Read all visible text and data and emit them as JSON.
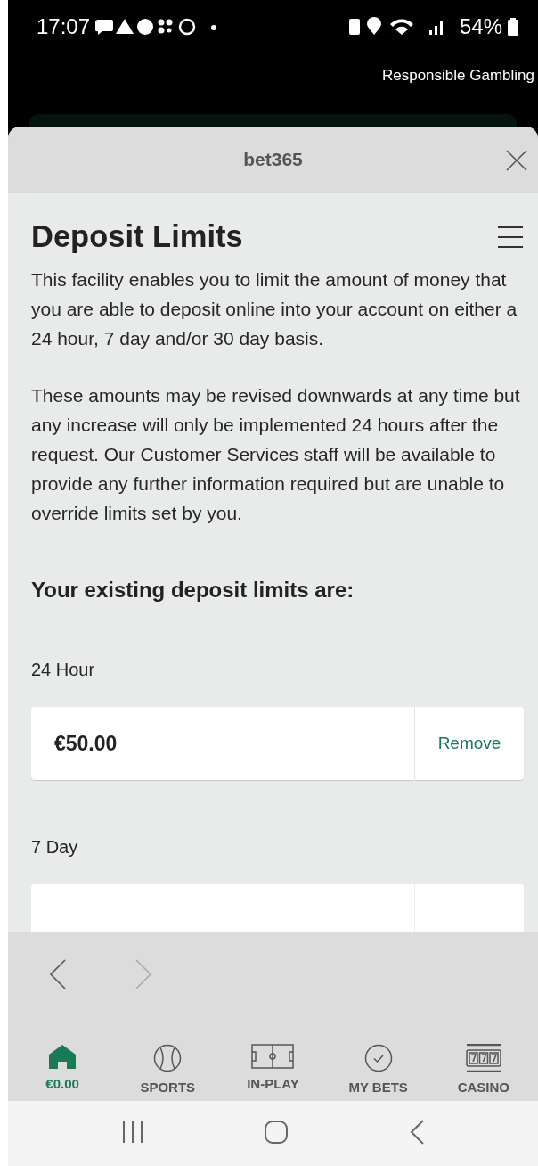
{
  "status_bar": {
    "time": "17:07",
    "battery": "54%"
  },
  "top_link": "Responsible Gambling",
  "sheet": {
    "title": "bet365"
  },
  "page": {
    "title": "Deposit Limits",
    "paragraphs": [
      "This facility enables you to limit the amount of money that you are able to deposit online into your account on either a 24 hour, 7 day and/or 30 day basis.",
      "These amounts may be revised downwards at any time but any increase will only be implemented 24 hours after the request. Our Customer Services staff will be available to provide any further information required but are unable to override limits set by you."
    ],
    "subheading": "Your existing deposit limits are:",
    "limits": [
      {
        "period": "24 Hour",
        "amount": "€50.00",
        "action": "Remove"
      },
      {
        "period": "7 Day"
      }
    ]
  },
  "browser_nav": {
    "back_disabled": false,
    "forward_disabled": true
  },
  "tabs": [
    {
      "kind": "home",
      "label": "€0.00",
      "selected": true
    },
    {
      "kind": "sports",
      "label": "SPORTS",
      "selected": false
    },
    {
      "kind": "inplay",
      "label": "IN-PLAY",
      "selected": false
    },
    {
      "kind": "mybets",
      "label": "MY BETS",
      "selected": false
    },
    {
      "kind": "casino",
      "label": "CASINO",
      "selected": false
    }
  ]
}
